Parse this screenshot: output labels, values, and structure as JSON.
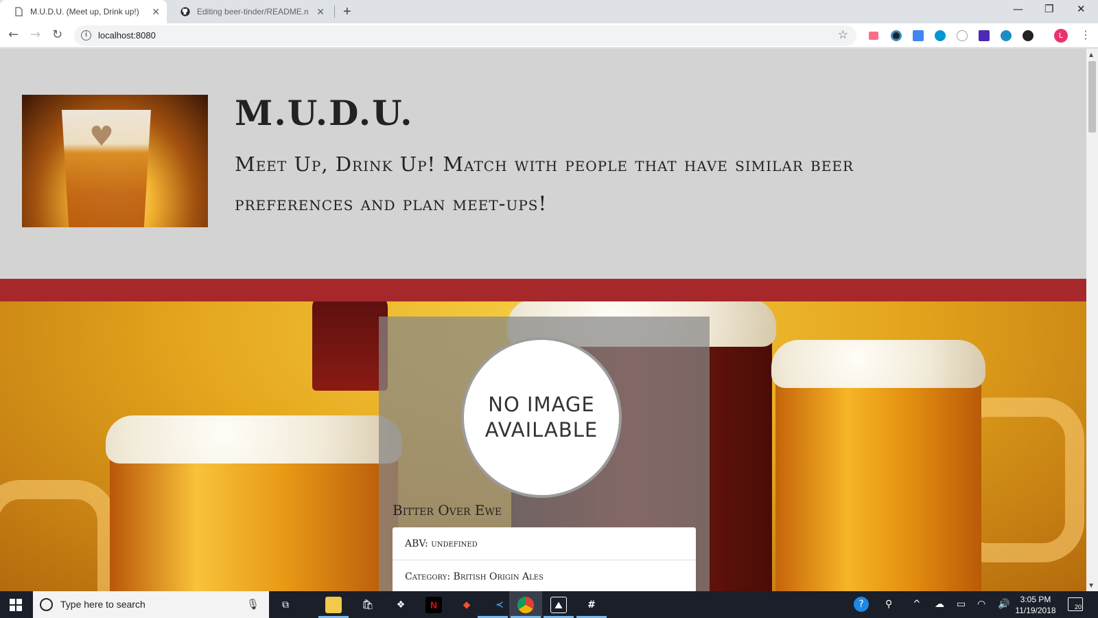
{
  "browser": {
    "tabs": [
      {
        "title": "M.U.D.U. (Meet up, Drink up!)",
        "icon": "page-icon",
        "active": true
      },
      {
        "title": "Editing beer-tinder/README.md",
        "icon": "github-icon",
        "active": false
      }
    ],
    "new_tab_glyph": "+",
    "window_controls": {
      "minimize": "—",
      "restore": "❐",
      "close": "✕"
    },
    "address": "localhost:8080",
    "profile_initial": "L",
    "extensions": [
      "cast-icon",
      "camera-extension-icon",
      "pen-extension-icon",
      "hp-icon",
      "circle-extension-icon",
      "mail-extension-icon",
      "m-extension-icon",
      "dark-extension-icon"
    ]
  },
  "page": {
    "site_title": "M.U.D.U.",
    "tagline": "Meet Up, Drink Up! Match with people that have similar beer preferences and plan meet-ups!",
    "accent_red": "#a7282b",
    "card": {
      "image_placeholder_line1": "NO IMAGE",
      "image_placeholder_line2": "AVAILABLE",
      "beer_name": "Bitter Over Ewe",
      "details": [
        {
          "text": "ABV: undefined"
        },
        {
          "text": "Category: British Origin Ales"
        }
      ]
    }
  },
  "taskbar": {
    "search_placeholder": "Type here to search",
    "pinned": [
      "task-view-icon",
      "file-explorer-icon",
      "store-icon",
      "dropbox-icon",
      "netflix-icon",
      "git-icon",
      "vscode-icon",
      "chrome-icon",
      "photos-icon",
      "slack-icon"
    ],
    "time": "3:05 PM",
    "date": "11/19/2018",
    "notification_count": "20"
  }
}
